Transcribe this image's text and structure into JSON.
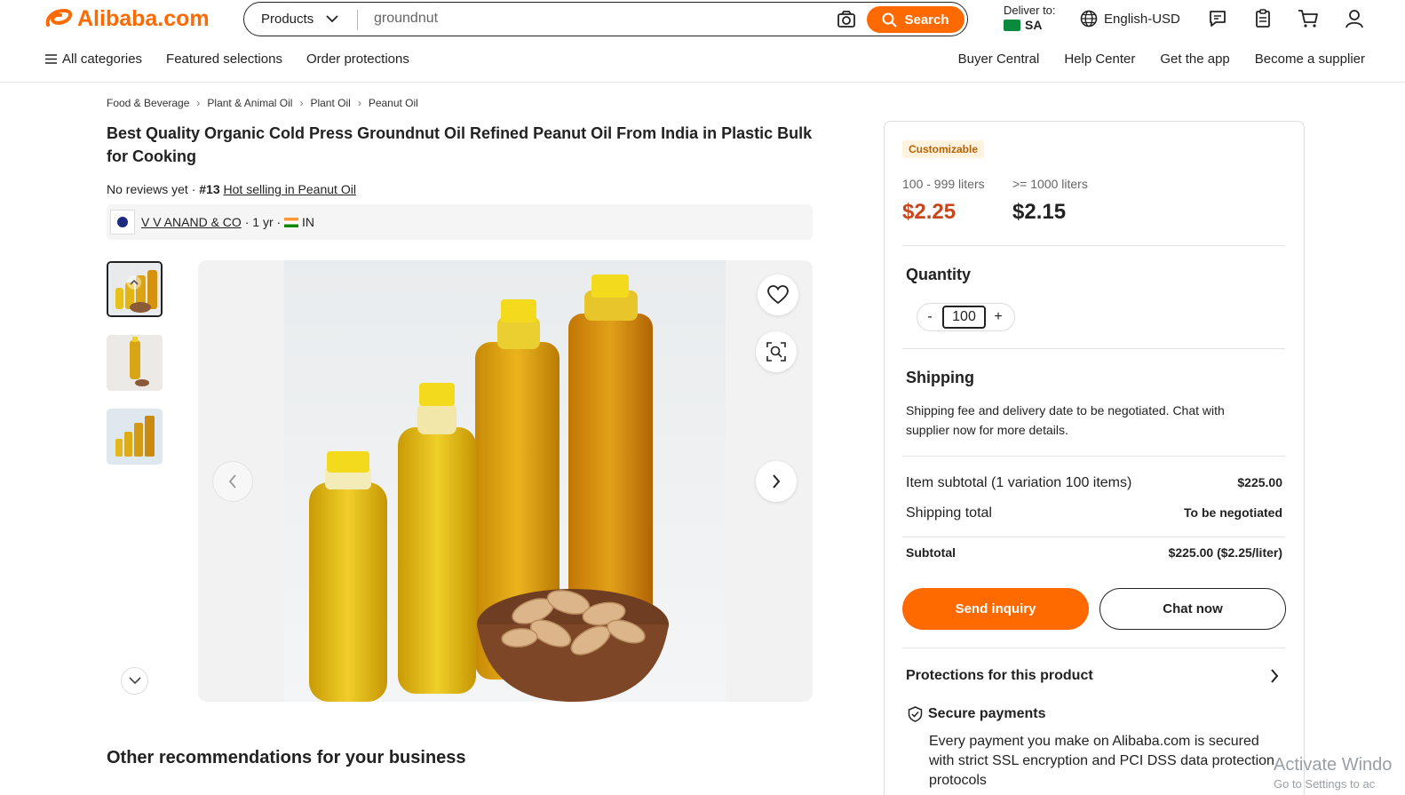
{
  "header": {
    "logo_text": "Alibaba.com",
    "search_category": "Products",
    "search_value": "groundnut",
    "search_button": "Search",
    "deliver_label": "Deliver to:",
    "deliver_country": "SA",
    "language": "English-USD",
    "icons": [
      "message-icon",
      "orders-icon",
      "cart-icon",
      "account-icon"
    ],
    "nav_left": [
      "All categories",
      "Featured selections",
      "Order protections"
    ],
    "nav_right": [
      "Buyer Central",
      "Help Center",
      "Get the app",
      "Become a supplier"
    ]
  },
  "breadcrumb": [
    "Food & Beverage",
    "Plant & Animal Oil",
    "Plant Oil",
    "Peanut Oil"
  ],
  "product": {
    "title": "Best Quality Organic Cold Press Groundnut Oil Refined Peanut Oil From India in Plastic Bulk for Cooking",
    "reviews": "No reviews yet",
    "rank": "#13",
    "rank_link": "Hot selling in Peanut Oil",
    "supplier_name": "V V ANAND & CO",
    "supplier_years": "1 yr",
    "supplier_country": "IN"
  },
  "panel": {
    "badge": "Customizable",
    "tiers": [
      {
        "range": "100 - 999 liters",
        "price": "$2.25"
      },
      {
        "range": ">= 1000 liters",
        "price": "$2.15"
      }
    ],
    "quantity_title": "Quantity",
    "quantity_value": "100",
    "minus": "-",
    "plus": "+",
    "shipping_title": "Shipping",
    "shipping_text": "Shipping fee and delivery date to be negotiated. Chat with supplier now for more details.",
    "item_subtotal_label": "Item subtotal (1 variation 100 items)",
    "item_subtotal_value": "$225.00",
    "shipping_total_label": "Shipping total",
    "shipping_total_value": "To be negotiated",
    "subtotal_label": "Subtotal",
    "subtotal_value": "$225.00 ($2.25/liter)",
    "send_inquiry": "Send inquiry",
    "chat_now": "Chat now",
    "protections_title": "Protections for this product",
    "secure_title": "Secure payments",
    "secure_text": "Every payment you make on Alibaba.com is secured with strict SSL encryption and PCI DSS data protection protocols"
  },
  "recommendations_title": "Other recommendations for your business",
  "watermark": {
    "line1": "Activate Windo",
    "line2": "Go to Settings to ac"
  },
  "colors": {
    "accent": "#ff6a00",
    "price": "#c8461a"
  }
}
